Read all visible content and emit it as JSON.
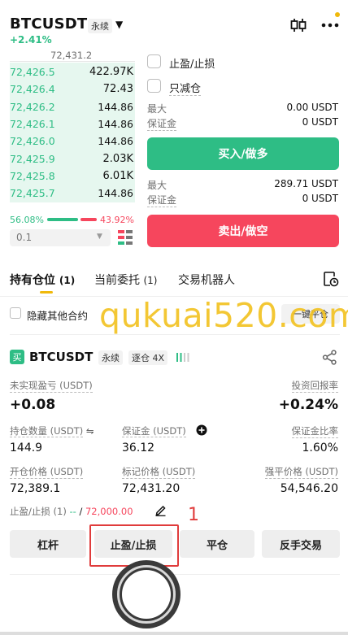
{
  "header": {
    "symbol": "BTCUSDT",
    "contract_type": "永续",
    "change": "+2.41%"
  },
  "orderbook": {
    "mark_price": "72,431.2",
    "rows": [
      {
        "price": "72,426.5",
        "qty": "422.97K"
      },
      {
        "price": "72,426.4",
        "qty": "72.43"
      },
      {
        "price": "72,426.2",
        "qty": "144.86"
      },
      {
        "price": "72,426.1",
        "qty": "144.86"
      },
      {
        "price": "72,426.0",
        "qty": "144.86"
      },
      {
        "price": "72,425.9",
        "qty": "2.03K"
      },
      {
        "price": "72,425.8",
        "qty": "6.01K"
      },
      {
        "price": "72,425.7",
        "qty": "144.86"
      }
    ],
    "buy_ratio": "56.08%",
    "sell_ratio": "43.92%",
    "step": "0.1"
  },
  "order_panel": {
    "tpsl_label": "止盈/止损",
    "reduce_only_label": "只减仓",
    "buy": {
      "max_label": "最大",
      "max_value": "0.00 USDT",
      "margin_label": "保证金",
      "margin_value": "0 USDT",
      "button": "买入/做多"
    },
    "sell": {
      "max_label": "最大",
      "max_value": "289.71 USDT",
      "margin_label": "保证金",
      "margin_value": "0 USDT",
      "button": "卖出/做空"
    }
  },
  "tabs": {
    "positions": "持有仓位",
    "positions_count": "(1)",
    "open_orders": "当前委托",
    "open_orders_count": "(1)",
    "bots": "交易机器人"
  },
  "filters": {
    "hide_other": "隐藏其他合约",
    "close_all": "一键平仓"
  },
  "watermark": "qukuai520.com",
  "position": {
    "side": "买",
    "symbol": "BTCUSDT",
    "contract_type": "永续",
    "margin_mode": "逐仓 4X",
    "upnl_label": "未实现盈亏 (USDT)",
    "upnl_value": "+0.08",
    "roi_label": "投资回报率",
    "roi_value": "+0.24%",
    "size_label": "持仓数量 (USDT)",
    "size_value": "144.9",
    "margin_label": "保证金 (USDT)",
    "margin_value": "36.12",
    "margin_ratio_label": "保证金比率",
    "margin_ratio_value": "1.60%",
    "entry_label": "开仓价格 (USDT)",
    "entry_value": "72,389.1",
    "mark_label": "标记价格 (USDT)",
    "mark_value": "72,431.20",
    "liq_label": "强平价格 (USDT)",
    "liq_value": "54,546.20",
    "tpsl_label": "止盈/止损 (1)",
    "tpsl_tp": "--",
    "tpsl_sep": "/",
    "tpsl_sl": "72,000.00"
  },
  "actions": {
    "leverage": "杠杆",
    "tpsl": "止盈/止损",
    "close": "平仓",
    "reverse": "反手交易"
  },
  "annotation": {
    "step_number": "1",
    "color": "#e03c3c"
  },
  "colors": {
    "buy": "#2ebd85",
    "sell": "#f6465d",
    "accent": "#f0b90b"
  }
}
